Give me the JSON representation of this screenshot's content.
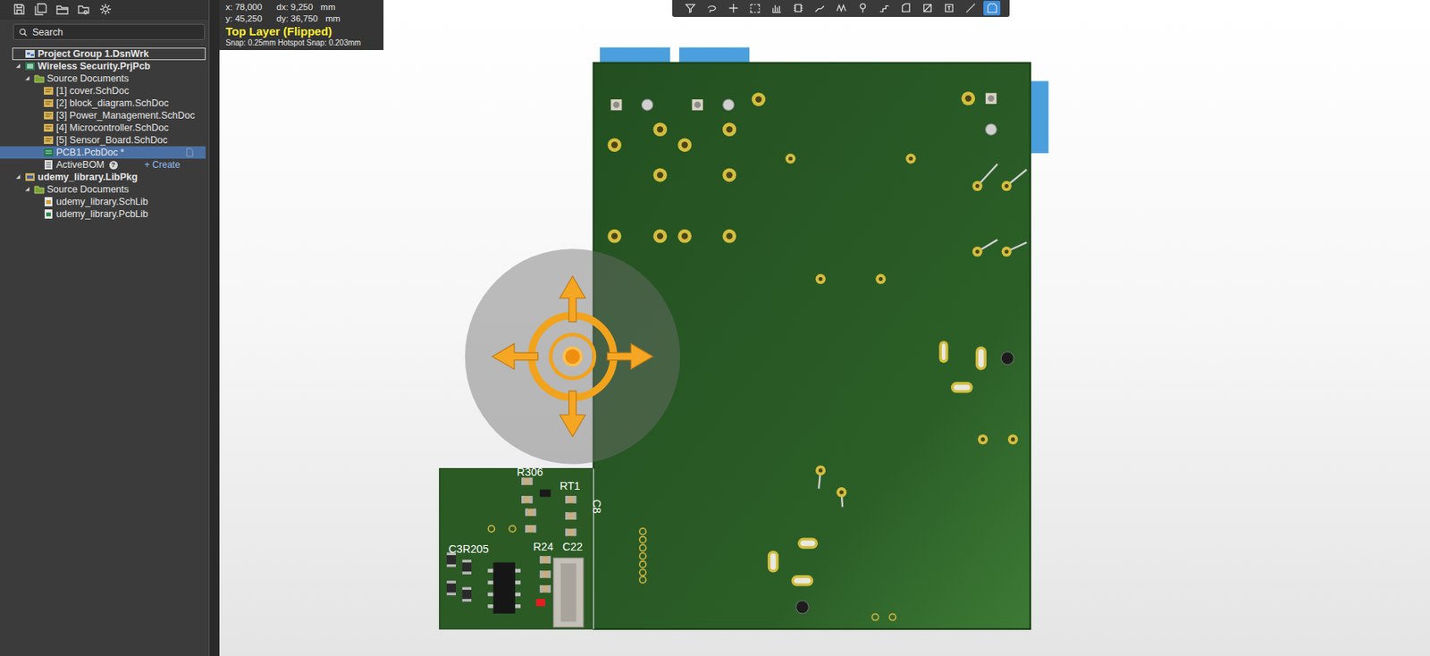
{
  "info": {
    "coords": [
      {
        "axis": "x:",
        "value": "78,000",
        "delta_axis": "dx:",
        "delta": "9,250",
        "unit": "mm"
      },
      {
        "axis": "y:",
        "value": "45,250",
        "delta_axis": "dy:",
        "delta": "36,750",
        "unit": "mm"
      }
    ],
    "layer": "Top Layer (Flipped)",
    "snap": "Snap: 0.25mm Hotspot Snap: 0.203mm"
  },
  "toolbar": {
    "tools": [
      {
        "selected": false
      },
      {
        "selected": false
      },
      {
        "selected": false
      },
      {
        "selected": false
      },
      {
        "selected": false
      },
      {
        "selected": false
      },
      {
        "selected": false
      },
      {
        "selected": false
      },
      {
        "selected": false
      },
      {
        "selected": false
      },
      {
        "selected": false
      },
      {
        "selected": false
      },
      {
        "selected": false
      },
      {
        "selected": false
      },
      {
        "selected": true
      }
    ]
  },
  "panel": {
    "search": {
      "placeholder": "Search"
    },
    "tree": [
      {
        "label": "Project Group 1.DsnWrk",
        "kind": "workspace",
        "depth": 0,
        "expanded": false,
        "selected": false,
        "focused": true
      },
      {
        "label": "Wireless Security.PrjPcb",
        "kind": "project",
        "depth": 1,
        "expanded": true,
        "selected": false,
        "focused": false
      },
      {
        "label": "Source Documents",
        "kind": "folder",
        "depth": 2,
        "expanded": true,
        "selected": false,
        "focused": false
      },
      {
        "label": "[1] cover.SchDoc",
        "kind": "schdoc",
        "depth": 3,
        "expanded": false,
        "selected": false,
        "focused": false
      },
      {
        "label": "[2] block_diagram.SchDoc",
        "kind": "schdoc",
        "depth": 3,
        "expanded": false,
        "selected": false,
        "focused": false
      },
      {
        "label": "[3] Power_Management.SchDoc",
        "kind": "schdoc",
        "depth": 3,
        "expanded": false,
        "selected": false,
        "focused": false
      },
      {
        "label": "[4] Microcontroller.SchDoc",
        "kind": "schdoc",
        "depth": 3,
        "expanded": false,
        "selected": false,
        "focused": false
      },
      {
        "label": "[5] Sensor_Board.SchDoc",
        "kind": "schdoc",
        "depth": 3,
        "expanded": false,
        "selected": false,
        "focused": false
      },
      {
        "label": "PCB1.PcbDoc *",
        "kind": "pcbdoc",
        "depth": 3,
        "expanded": false,
        "selected": true,
        "focused": false
      },
      {
        "label": "ActiveBOM",
        "kind": "bom",
        "depth": 3,
        "expanded": false,
        "selected": false,
        "focused": false,
        "help": "?",
        "action": "+ Create"
      },
      {
        "label": "udemy_library.LibPkg",
        "kind": "libpkg",
        "depth": 1,
        "expanded": true,
        "selected": false,
        "focused": false
      },
      {
        "label": "Source Documents",
        "kind": "folder",
        "depth": 2,
        "expanded": true,
        "selected": false,
        "focused": false
      },
      {
        "label": "udemy_library.SchLib",
        "kind": "schlib",
        "depth": 3,
        "expanded": false,
        "selected": false,
        "focused": false
      },
      {
        "label": "udemy_library.PcbLib",
        "kind": "pcblib",
        "depth": 3,
        "expanded": false,
        "selected": false,
        "focused": false
      }
    ]
  },
  "pcb": {
    "silkscreen": [
      "R306",
      "RT1",
      "C8",
      "R24",
      "C22",
      "C3R205"
    ]
  }
}
